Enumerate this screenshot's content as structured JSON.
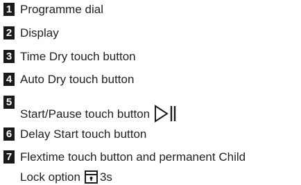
{
  "legend": {
    "items": [
      {
        "number": "1",
        "label": "Programme dial"
      },
      {
        "number": "2",
        "label": "Display"
      },
      {
        "number": "3",
        "label": "Time Dry touch button"
      },
      {
        "number": "4",
        "label": "Auto Dry touch button"
      },
      {
        "number": "5",
        "label": "Start/Pause touch button",
        "icon": "play-pause-icon"
      },
      {
        "number": "6",
        "label": "Delay Start touch button"
      },
      {
        "number": "7",
        "label_line1": "Flextime touch button and permanent Child",
        "label_line2": "Lock option",
        "icon": "child-lock-icon",
        "icon_suffix": "3s"
      }
    ]
  }
}
